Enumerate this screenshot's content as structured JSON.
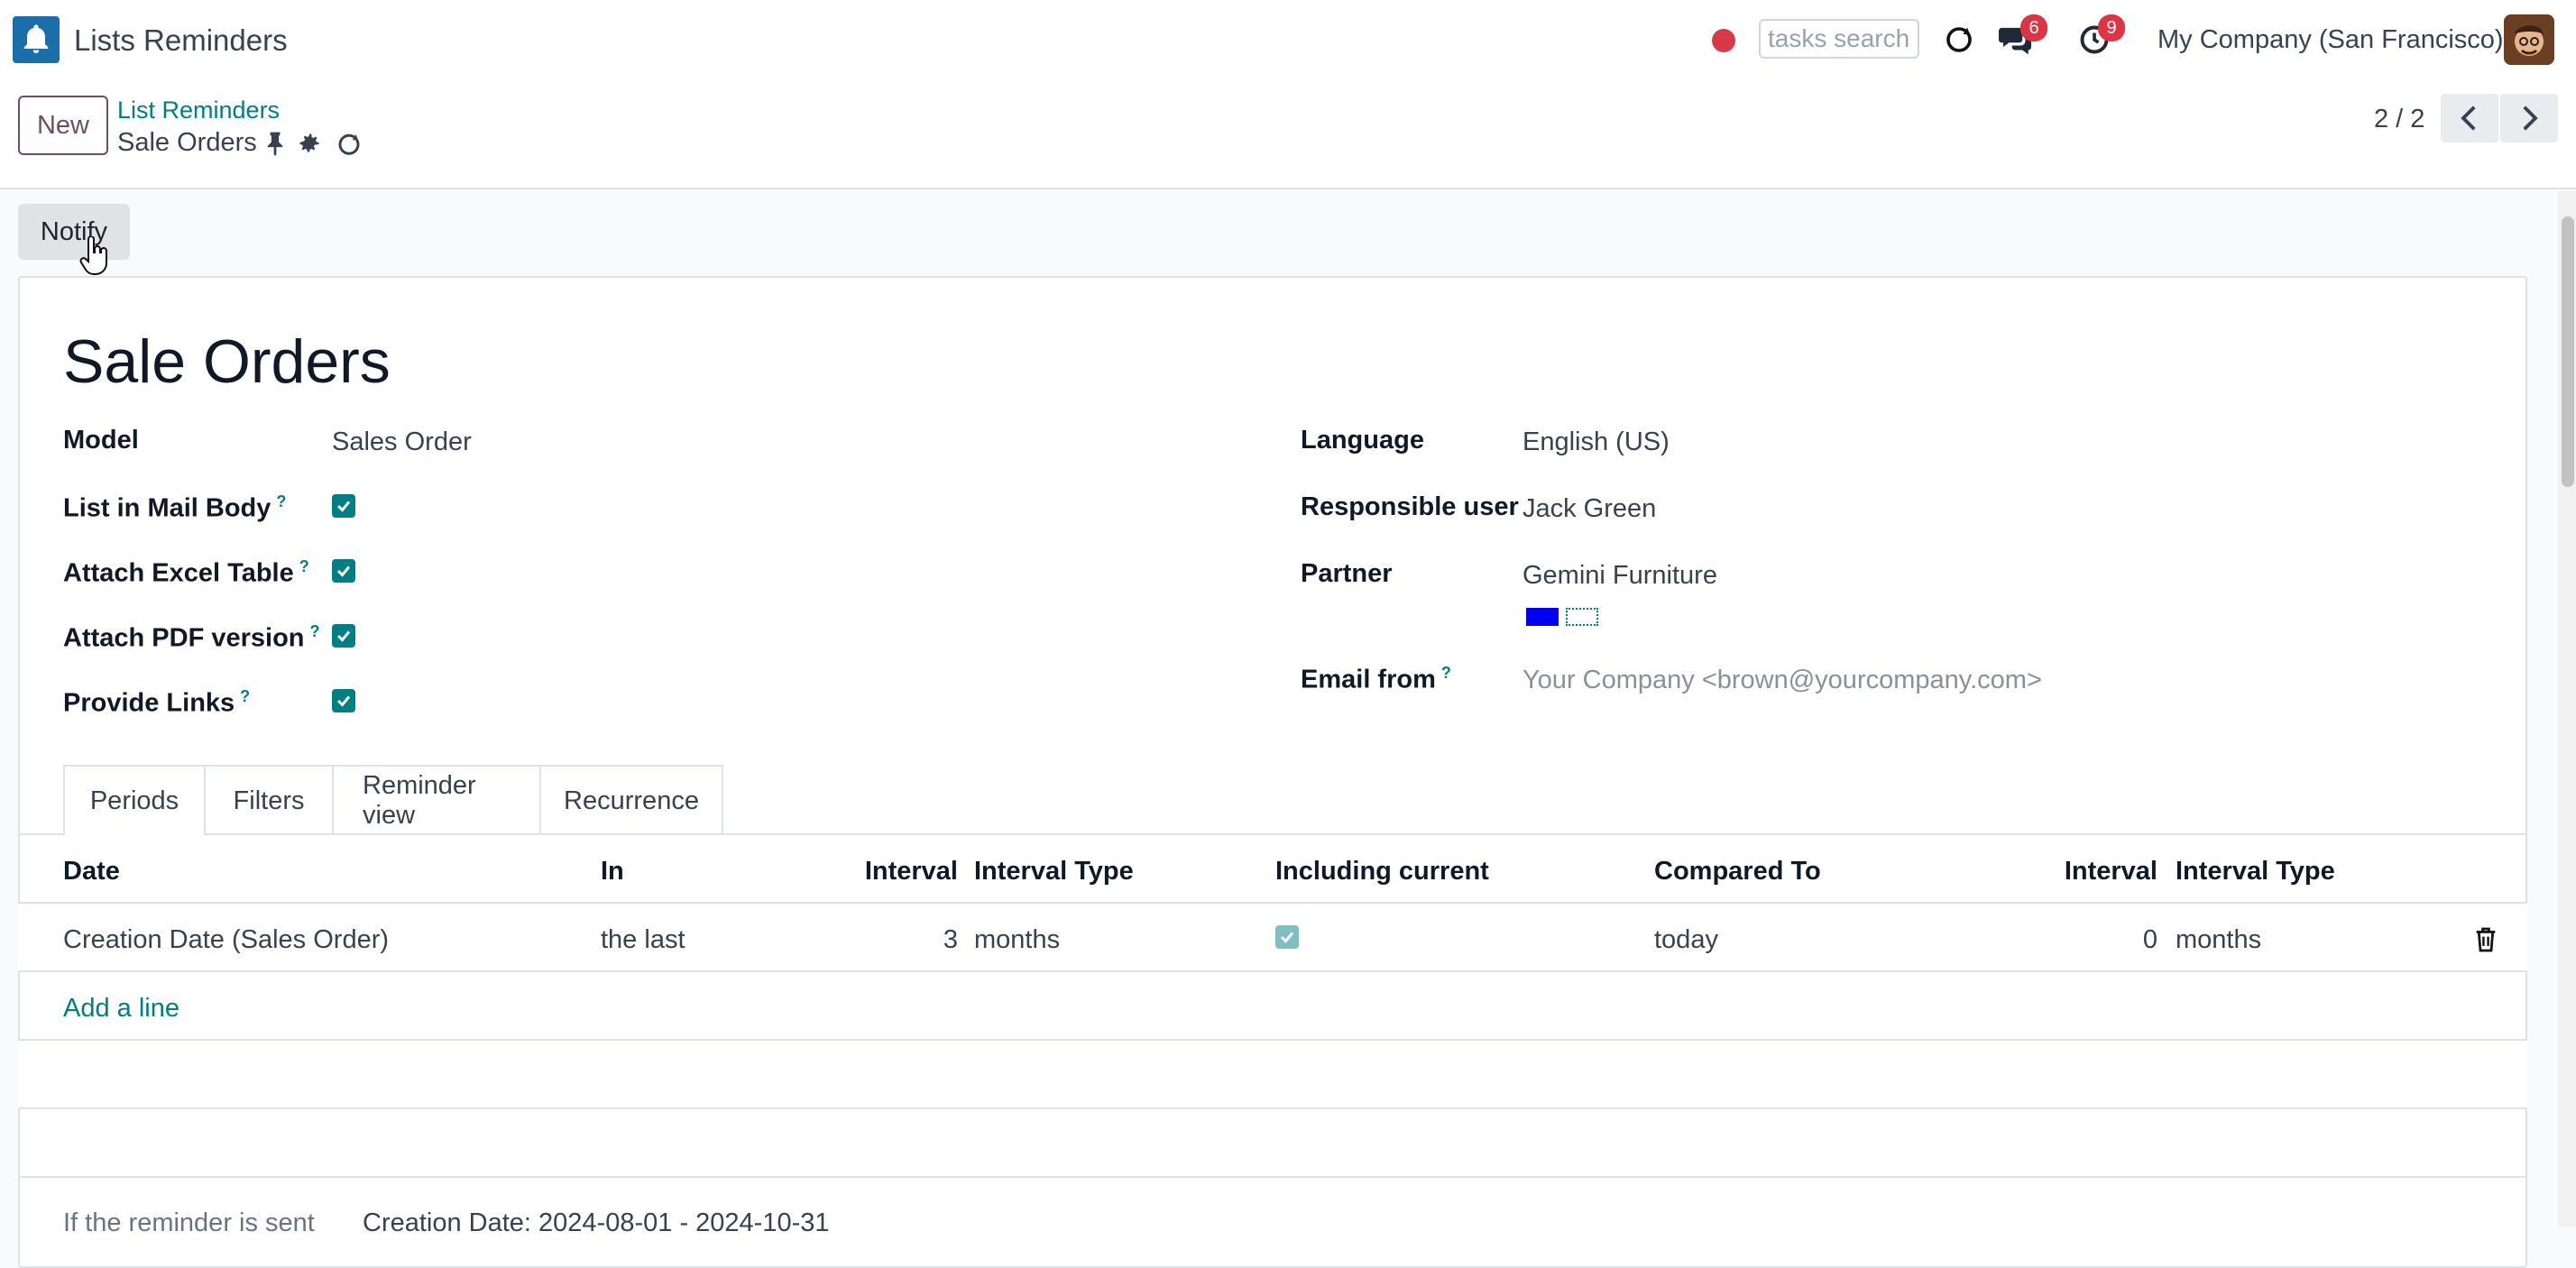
{
  "app": {
    "title": "Lists Reminders",
    "search_placeholder": "tasks search",
    "company": "My Company (San Francisco)",
    "messages_count": "6",
    "activities_count": "9"
  },
  "control": {
    "new_label": "New",
    "breadcrumb_parent": "List Reminders",
    "breadcrumb_current": "Sale Orders",
    "pager": "2 / 2"
  },
  "actions": {
    "notify_label": "Notify"
  },
  "record": {
    "title": "Sale Orders",
    "left_fields": [
      {
        "label": "Model",
        "value": "Sales Order"
      },
      {
        "label": "List in Mail Body",
        "help": "?",
        "checked": true
      },
      {
        "label": "Attach Excel Table",
        "help": "?",
        "checked": true
      },
      {
        "label": "Attach PDF version",
        "help": "?",
        "checked": true
      },
      {
        "label": "Provide Links",
        "help": "?",
        "checked": true
      }
    ],
    "right_fields": [
      {
        "label": "Language",
        "value": "English (US)"
      },
      {
        "label": "Responsible user",
        "value": "Jack Green"
      },
      {
        "label": "Partner",
        "value": "Gemini Furniture"
      },
      {
        "label": "Email from",
        "help": "?",
        "value": "Your Company <brown@yourcompany.com>"
      }
    ]
  },
  "tabs": [
    "Periods",
    "Filters",
    "Reminder view",
    "Recurrence"
  ],
  "table": {
    "headers": [
      "Date",
      "In",
      "Interval",
      "Interval Type",
      "Including current",
      "Compared To",
      "Interval",
      "Interval Type"
    ],
    "rows": [
      {
        "date": "Creation Date (Sales Order)",
        "in": "the last",
        "interval": "3",
        "interval_type": "months",
        "including_current": true,
        "compared_to": "today",
        "interval2": "0",
        "interval_type2": "months"
      }
    ],
    "add_line": "Add a line"
  },
  "footer": {
    "label": "If the reminder is sent",
    "value": "Creation Date: 2024-08-01 - 2024-10-31"
  },
  "colors": {
    "primary": "#714b67",
    "teal": "#017e84",
    "badge": "#dc3545"
  }
}
